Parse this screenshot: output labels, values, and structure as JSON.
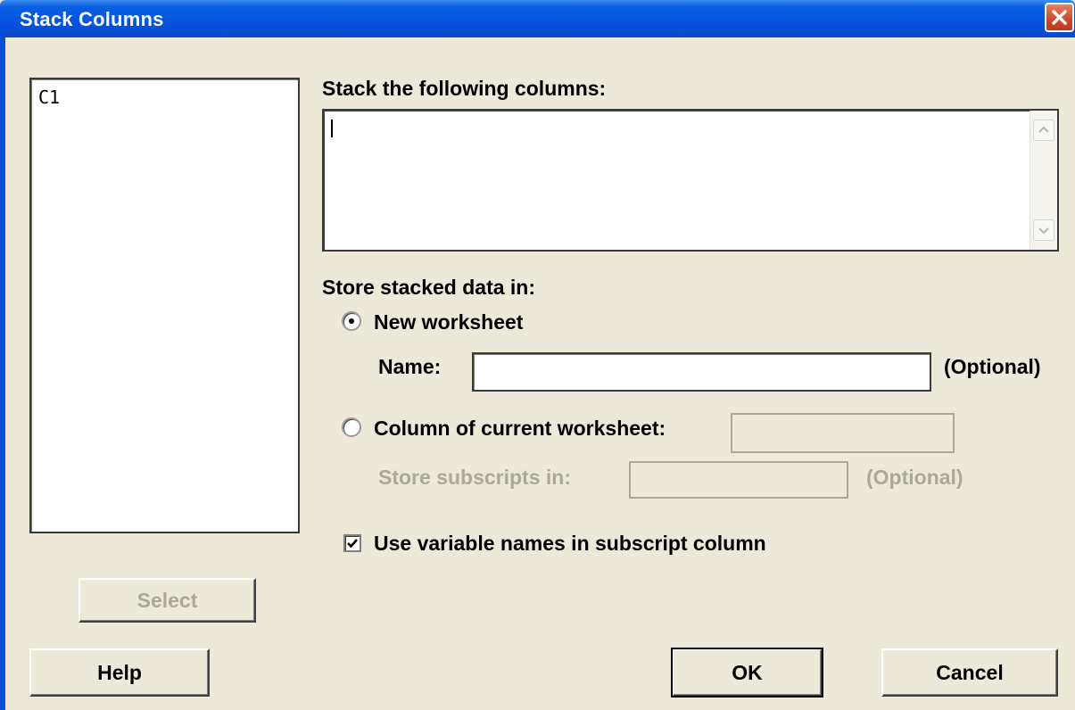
{
  "window": {
    "title": "Stack Columns"
  },
  "source_list": {
    "items": [
      "C1"
    ]
  },
  "stack": {
    "label": "Stack the following columns:",
    "value": ""
  },
  "store": {
    "label": "Store stacked data in:",
    "new_worksheet": {
      "label": "New worksheet",
      "selected": true
    },
    "name": {
      "label": "Name:",
      "value": "",
      "optional": "(Optional)"
    },
    "column_current": {
      "label": "Column of current worksheet:",
      "selected": false,
      "value": ""
    },
    "subscripts": {
      "label": "Store subscripts in:",
      "value": "",
      "optional": "(Optional)"
    }
  },
  "use_var_names": {
    "label": "Use variable names in subscript column",
    "checked": true
  },
  "buttons": {
    "select": "Select",
    "help": "Help",
    "ok": "OK",
    "cancel": "Cancel"
  },
  "icons": {
    "close": "close-icon",
    "scroll_up": "scroll-up-icon",
    "scroll_down": "scroll-down-icon",
    "check": "checkmark-icon"
  },
  "colors": {
    "titlebar": "#0554e3",
    "dialog_bg": "#ece9d8",
    "disabled_text": "#aca899",
    "close": "#d2452a"
  }
}
